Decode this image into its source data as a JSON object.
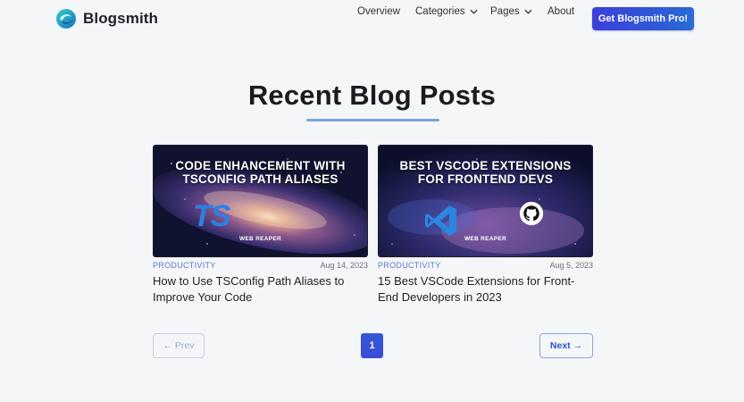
{
  "brand": {
    "name": "Blogsmith"
  },
  "nav": {
    "items": [
      {
        "label": "Overview",
        "has_dropdown": false
      },
      {
        "label": "Categories",
        "has_dropdown": true
      },
      {
        "label": "Pages",
        "has_dropdown": true
      },
      {
        "label": "About",
        "has_dropdown": false
      }
    ],
    "cta": "Get Blogsmith Pro!"
  },
  "main": {
    "heading": "Recent Blog Posts",
    "posts": [
      {
        "image_title_line1": "CODE ENHANCEMENT WITH",
        "image_title_line2": "TSCONFIG PATH ALIASES",
        "image_logo_text": "TS",
        "image_brand": "WEB REAPER",
        "category": "PRODUCTIVITY",
        "date": "Aug 14, 2023",
        "title": "How to Use TSConfig Path Aliases to Improve Your Code"
      },
      {
        "image_title_line1": "BEST VSCODE EXTENSIONS",
        "image_title_line2": "FOR FRONTEND DEVS",
        "image_brand": "WEB REAPER",
        "category": "PRODUCTIVITY",
        "date": "Aug 5, 2023",
        "title": "15 Best VSCode Extensions for Front-End Developers in 2023"
      }
    ]
  },
  "pagination": {
    "prev": "← Prev",
    "current": "1",
    "next": "Next →"
  },
  "colors": {
    "accent": "#3a4fd7",
    "category": "#5b78d0",
    "background": "#f5f6f8"
  },
  "icons": {
    "logo": "blogsmith-swirl-icon",
    "dropdown": "chevron-down-icon",
    "vscode": "vscode-icon",
    "github": "github-icon"
  }
}
